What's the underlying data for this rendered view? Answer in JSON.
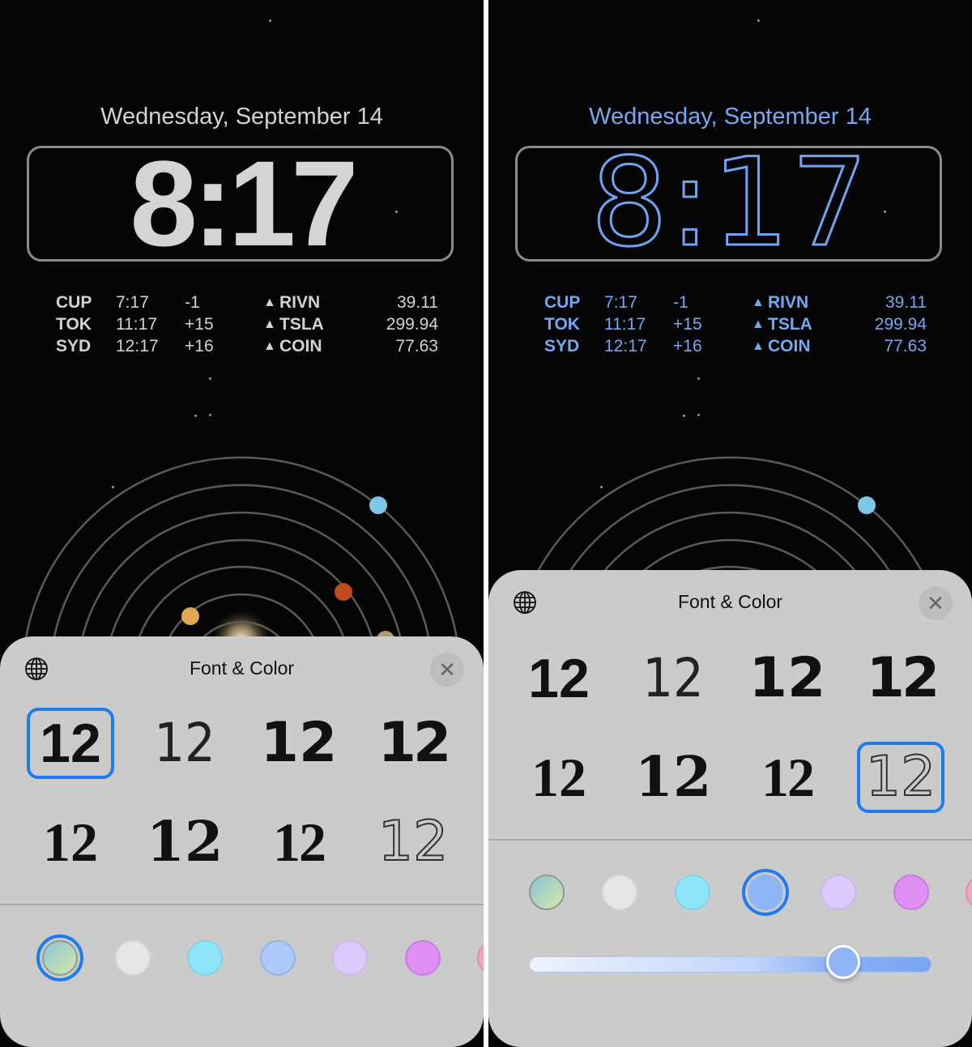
{
  "panels": [
    {
      "date": "Wednesday, September 14",
      "time": "8:17",
      "world_clock": [
        {
          "city": "CUP",
          "time": "7:17",
          "offset": "-1"
        },
        {
          "city": "TOK",
          "time": "11:17",
          "offset": "+15"
        },
        {
          "city": "SYD",
          "time": "12:17",
          "offset": "+16"
        }
      ],
      "stocks": [
        {
          "arrow": "▲",
          "ticker": "RIVN",
          "price": "39.11"
        },
        {
          "arrow": "▲",
          "ticker": "TSLA",
          "price": "299.94"
        },
        {
          "arrow": "▲",
          "ticker": "COIN",
          "price": "77.63"
        }
      ],
      "text_color": "#d2d2d2",
      "sheet": {
        "title": "Font & Color",
        "globe_icon": "globe-icon",
        "close_icon": "close-icon",
        "close_glyph": "✕",
        "font_sample": "12",
        "selected_font_index": 0,
        "selected_color_index": 0
      }
    },
    {
      "date": "Wednesday, September 14",
      "time": "8:17",
      "world_clock": [
        {
          "city": "CUP",
          "time": "7:17",
          "offset": "-1"
        },
        {
          "city": "TOK",
          "time": "11:17",
          "offset": "+15"
        },
        {
          "city": "SYD",
          "time": "12:17",
          "offset": "+16"
        }
      ],
      "stocks": [
        {
          "arrow": "▲",
          "ticker": "RIVN",
          "price": "39.11"
        },
        {
          "arrow": "▲",
          "ticker": "TSLA",
          "price": "299.94"
        },
        {
          "arrow": "▲",
          "ticker": "COIN",
          "price": "77.63"
        }
      ],
      "text_color": "#76a8f0",
      "sheet": {
        "title": "Font & Color",
        "globe_icon": "globe-icon",
        "close_icon": "close-icon",
        "close_glyph": "✕",
        "font_sample": "12",
        "selected_font_index": 7,
        "selected_color_index": 3,
        "color_intensity": 0.78
      }
    }
  ],
  "font_options": [
    "bold-sans",
    "thin-sans",
    "rounded-bold",
    "stencil",
    "serif",
    "heavy-serif",
    "slab-serif",
    "outline-rails"
  ],
  "color_options": [
    {
      "name": "gradient",
      "fill": "linear-gradient(135deg,#8fc4d6,#d2e6a8)",
      "border": "#8c9a92"
    },
    {
      "name": "white",
      "fill": "#e6e6e6",
      "border": "#d8d8d8"
    },
    {
      "name": "cyan",
      "fill": "#8fe4f8",
      "border": "#7fd2e8"
    },
    {
      "name": "blue",
      "fill": "#adc8fb",
      "border": "#95b3e8"
    },
    {
      "name": "lavender",
      "fill": "#dccafc",
      "border": "#cbb8ee"
    },
    {
      "name": "magenta",
      "fill": "#e08ff5",
      "border": "#c97ce0"
    },
    {
      "name": "pink",
      "fill": "#f2a6c4",
      "border": "#e08fb0"
    }
  ],
  "selected_blue_swatch_fill": "#8fb5f6"
}
